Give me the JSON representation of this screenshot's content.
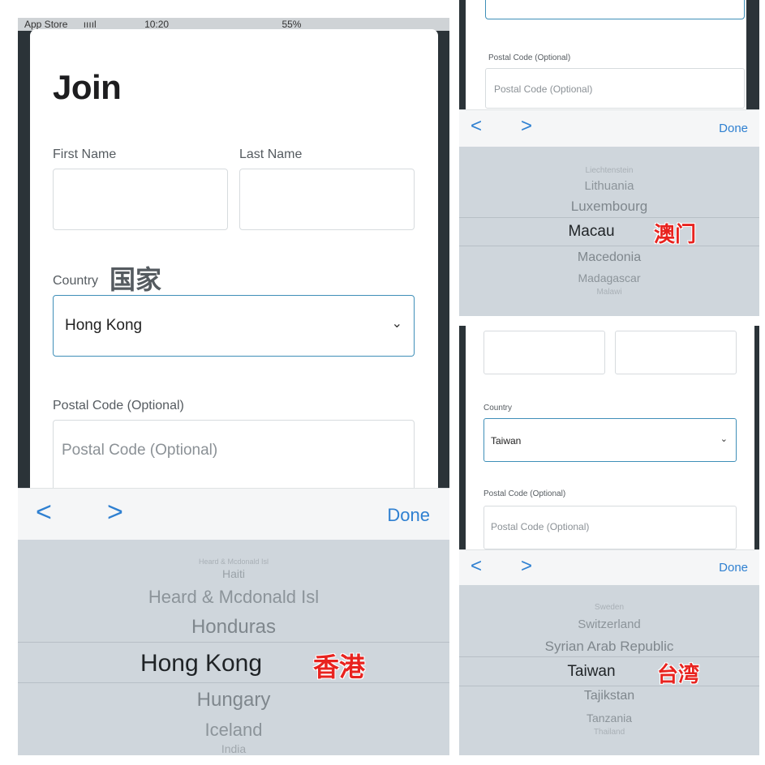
{
  "left": {
    "status": {
      "carrier": "App Store",
      "signal": "ııııl",
      "time": "10:20",
      "battery": "55%"
    },
    "title": "Join",
    "first_name_label": "First Name",
    "last_name_label": "Last Name",
    "country_label": "Country",
    "country_annotation": "国家",
    "country_value": "Hong Kong",
    "postal_label": "Postal Code (Optional)",
    "postal_placeholder": "Postal Code (Optional)",
    "toolbar": {
      "prev": "<",
      "next": ">",
      "done": "Done"
    },
    "picker": {
      "items": [
        "Heard & Mcdonald Isl",
        "Haiti",
        "Heard & Mcdonald Isl",
        "Honduras",
        "Hong Kong",
        "Hungary",
        "Iceland",
        "India"
      ],
      "selected_annotation": "香港"
    }
  },
  "top_right": {
    "postal_label": "Postal Code (Optional)",
    "postal_placeholder": "Postal Code (Optional)",
    "toolbar": {
      "prev": "<",
      "next": ">",
      "done": "Done"
    },
    "picker": {
      "items": [
        "Liechtenstein",
        "Lithuania",
        "Luxembourg",
        "Macau",
        "Macedonia",
        "Madagascar",
        "Malawi"
      ],
      "selected_annotation": "澳门"
    }
  },
  "bottom_right": {
    "country_label": "Country",
    "country_value": "Taiwan",
    "postal_label": "Postal Code (Optional)",
    "postal_placeholder": "Postal Code (Optional)",
    "toolbar": {
      "prev": "<",
      "next": ">",
      "done": "Done"
    },
    "picker": {
      "items": [
        "Sweden",
        "Switzerland",
        "Syrian Arab Republic",
        "Taiwan",
        "Tajikstan",
        "Tanzania",
        "Thailand"
      ],
      "selected_annotation": "台湾"
    }
  },
  "colors": {
    "accent": "#2f80d1",
    "annotation": "#e8231f",
    "picker_bg": "#cfd6dc",
    "focus_border": "#3f8fb8"
  }
}
